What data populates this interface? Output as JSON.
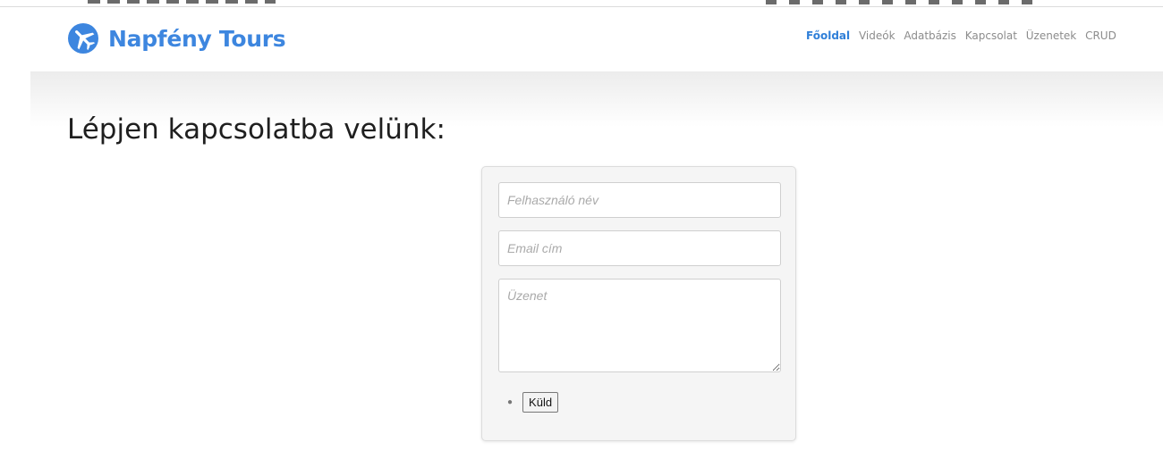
{
  "brand": {
    "name": "Napfény Tours",
    "logo_icon": "airplane-logo-icon",
    "color": "#3d86df"
  },
  "nav": {
    "items": [
      {
        "label": "Főoldal",
        "active": true
      },
      {
        "label": "Videók",
        "active": false
      },
      {
        "label": "Adatbázis",
        "active": false
      },
      {
        "label": "Kapcsolat",
        "active": false
      },
      {
        "label": "Üzenetek",
        "active": false
      },
      {
        "label": "CRUD",
        "active": false
      }
    ],
    "active_color": "#2f7fd8"
  },
  "page": {
    "heading": "Lépjen kapcsolatba velünk:"
  },
  "form": {
    "username_placeholder": "Felhasználó név",
    "email_placeholder": "Email cím",
    "message_placeholder": "Üzenet",
    "submit_label": "Küld"
  }
}
